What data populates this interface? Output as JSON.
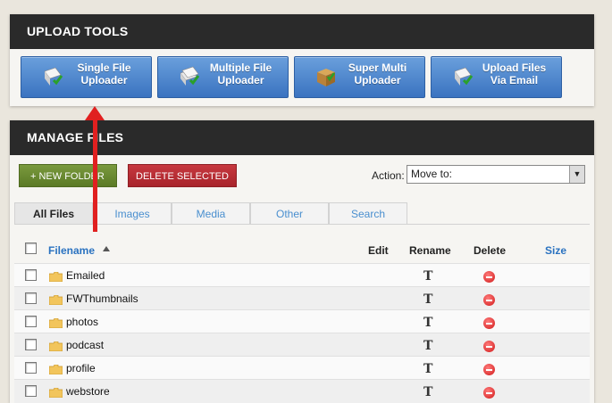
{
  "upload_tools": {
    "title": "UPLOAD TOOLS",
    "buttons": [
      {
        "label": "Single File\nUploader",
        "icon": "single-file-uploader-icon"
      },
      {
        "label": "Multiple File\nUploader",
        "icon": "multiple-file-uploader-icon"
      },
      {
        "label": "Super Multi\nUploader",
        "icon": "box-icon"
      },
      {
        "label": "Upload Files\nVia Email",
        "icon": "email-upload-icon"
      }
    ]
  },
  "manage_files": {
    "title": "MANAGE FILES",
    "new_folder_label": "+  NEW FOLDER",
    "delete_selected_label": "DELETE SELECTED",
    "action_label": "Action:",
    "action_value": "Move to:",
    "tabs": [
      "All Files",
      "Images",
      "Media",
      "Other",
      "Search"
    ],
    "columns": {
      "filename": "Filename",
      "edit": "Edit",
      "rename": "Rename",
      "delete": "Delete",
      "size": "Size"
    },
    "files": [
      {
        "name": "Emailed"
      },
      {
        "name": "FWThumbnails"
      },
      {
        "name": "photos"
      },
      {
        "name": "podcast"
      },
      {
        "name": "profile"
      },
      {
        "name": "webstore"
      }
    ]
  },
  "colors": {
    "header_bg": "#2a2a2a",
    "tool_button_blue": "#4a84cc",
    "new_folder_green": "#6a8a32",
    "delete_red": "#b52e35",
    "link_blue": "#2a72c0",
    "annotation_arrow": "#e02020"
  }
}
